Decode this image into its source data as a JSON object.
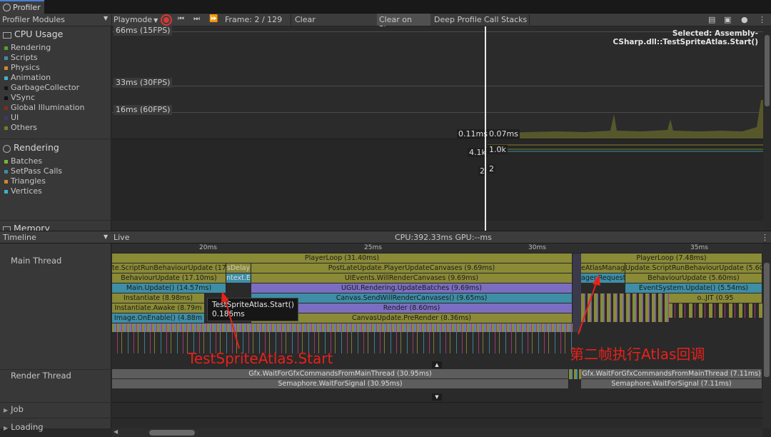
{
  "window": {
    "tab_title": "Profiler"
  },
  "toolbar": {
    "modules_label": "Profiler Modules",
    "playmode_label": "Playmode",
    "frame_label": "Frame: 2 / 129",
    "clear_label": "Clear",
    "clear_on_play_label": "Clear on Play",
    "deep_profile_label": "Deep Profile",
    "call_stacks_label": "Call Stacks"
  },
  "cpu_module": {
    "title": "CPU Usage",
    "legend": [
      {
        "label": "Rendering",
        "color": "#5b9c2f"
      },
      {
        "label": "Scripts",
        "color": "#3e8ea6"
      },
      {
        "label": "Physics",
        "color": "#d7822c"
      },
      {
        "label": "Animation",
        "color": "#3bb5c9"
      },
      {
        "label": "GarbageCollector",
        "color": "#151515"
      },
      {
        "label": "VSync",
        "color": "#101010"
      },
      {
        "label": "Global Illumination",
        "color": "#8a2a18"
      },
      {
        "label": "UI",
        "color": "#44356f"
      },
      {
        "label": "Others",
        "color": "#757a2b"
      }
    ]
  },
  "rendering_module": {
    "title": "Rendering",
    "legend": [
      {
        "label": "Batches",
        "color": "#7ab53a"
      },
      {
        "label": "SetPass Calls",
        "color": "#3e8ea6"
      },
      {
        "label": "Triangles",
        "color": "#d7822c"
      },
      {
        "label": "Vertices",
        "color": "#3bb5c9"
      }
    ]
  },
  "memory_module": {
    "title": "Memory"
  },
  "chart": {
    "fps_labels": [
      "66ms (15FPS)",
      "33ms (30FPS)",
      "16ms (60FPS)"
    ],
    "selected_text": "Selected: Assembly-CSharp.dll::TestSpriteAtlas.Start()",
    "cursor_values": [
      "0.11ms",
      "0.07ms"
    ],
    "render_values": [
      "4.1k",
      "1.0k",
      "2",
      "2"
    ]
  },
  "timeline": {
    "mode_label": "Timeline",
    "live_label": "Live",
    "stats": "CPU:392.33ms   GPU:--ms",
    "ticks": [
      "20ms",
      "25ms",
      "30ms",
      "35ms"
    ],
    "threads": [
      "Main Thread",
      "Render Thread",
      "Job",
      "Loading"
    ],
    "main_bars": [
      "PlayerLoop (31.40ms)",
      "te.ScriptRunBehaviourUpdate (17.",
      "PostLateUpdate.PlayerUpdateCanvases (9.69ms)",
      "BehaviourUpdate (17.10ms)",
      "UIEvents.WillRenderCanvases (9.69ms)",
      "Main.Update() (14.57ms)",
      "UGUI.Rendering.UpdateBatches (9.69ms)",
      "Instantiate (8.98ms)",
      "Canvas.SendWillRenderCanvases() (9.65ms)",
      "Instantiate.Awake (8.79m",
      "Render (8.60ms)",
      "Image.OnEnable() (4.88m",
      "CanvasUpdate.PreRender (8.36ms)",
      "PlayerLoop (7.48ms)",
      "eAtlasManag",
      "Update.ScriptRunBehaviourUpdate (5.60ms",
      "ager.Request",
      "BehaviourUpdate (5.60ms)",
      "EventSystem.Update() (5.54ms)",
      "o..JIT (0.95",
      "ntext.E",
      "sDelay"
    ],
    "render_bars": [
      "Gfx.WaitForGfxCommandsFromMainThread (30.95ms)",
      "Semaphore.WaitForSignal (30.95ms)",
      "Gfx.WaitForGfxCommandsFromMainThread (7.11ms)",
      "Semaphore.WaitForSignal (7.11ms)"
    ],
    "tooltip": {
      "title": "TestSpriteAtlas.Start()",
      "time": "0.186ms"
    }
  },
  "annotations": {
    "left_note": "TestSpriteAtlas.Start",
    "right_note": "第二帧执行Atlas回调",
    "color": "#e8211a"
  }
}
